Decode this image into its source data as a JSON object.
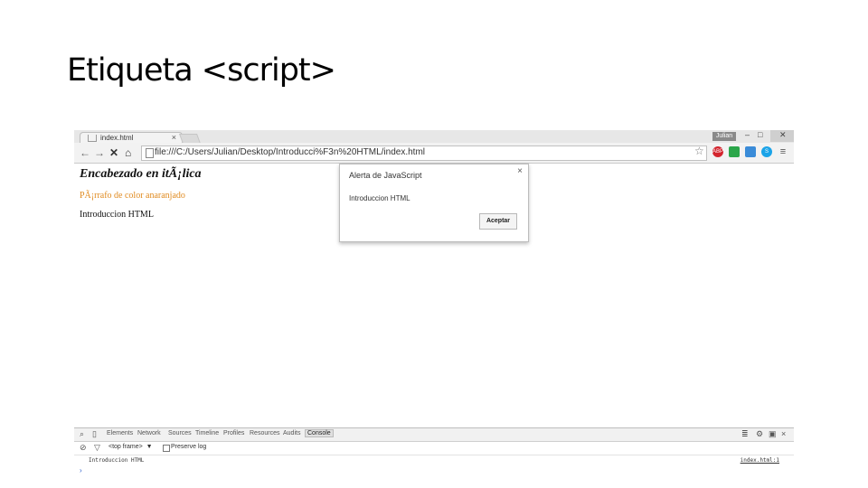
{
  "slide": {
    "title": "Etiqueta <script>"
  },
  "browser": {
    "tab_label": "index.html",
    "tab_close": "×",
    "user_badge": "Julian",
    "window_controls": {
      "minimize": "–",
      "maximize": "□",
      "close": "✕"
    },
    "nav": {
      "back": "←",
      "forward": "→",
      "reload": "✕",
      "home": "⌂"
    },
    "address": "file:///C:/Users/Julian/Desktop/Introducci%F3n%20HTML/index.html",
    "star": "☆",
    "extensions": [
      {
        "name": "adblock-icon",
        "text": "ABP",
        "color": "#d3242d"
      },
      {
        "name": "edit-icon",
        "text": "",
        "color": "#2ba64a"
      },
      {
        "name": "extension-icon",
        "text": "",
        "color": "#3a8bd8"
      },
      {
        "name": "skype-icon",
        "text": "S",
        "color": "#1aa3e8"
      },
      {
        "name": "menu-icon",
        "text": "≡",
        "color": "#777777"
      }
    ]
  },
  "page": {
    "heading": "Encabezado en itÃ¡lica",
    "orange_paragraph": "PÃ¡rrafo de color anaranjado",
    "plain_paragraph": "Introduccion HTML",
    "orange_color": "#e08a1e"
  },
  "alert": {
    "title": "Alerta de JavaScript",
    "message": "Introduccion HTML",
    "button": "Aceptar",
    "close": "×"
  },
  "devtools": {
    "tabs": [
      "Elements",
      "Network",
      "Sources",
      "Timeline",
      "Profiles",
      "Resources",
      "Audits",
      "Console"
    ],
    "active_tab": "Console",
    "frame_selector": "<top frame>",
    "preserve_log": "Preserve log",
    "log_message": "Introduccion HTML",
    "log_source": "index.html:1",
    "prompt": "›",
    "close": "×"
  }
}
